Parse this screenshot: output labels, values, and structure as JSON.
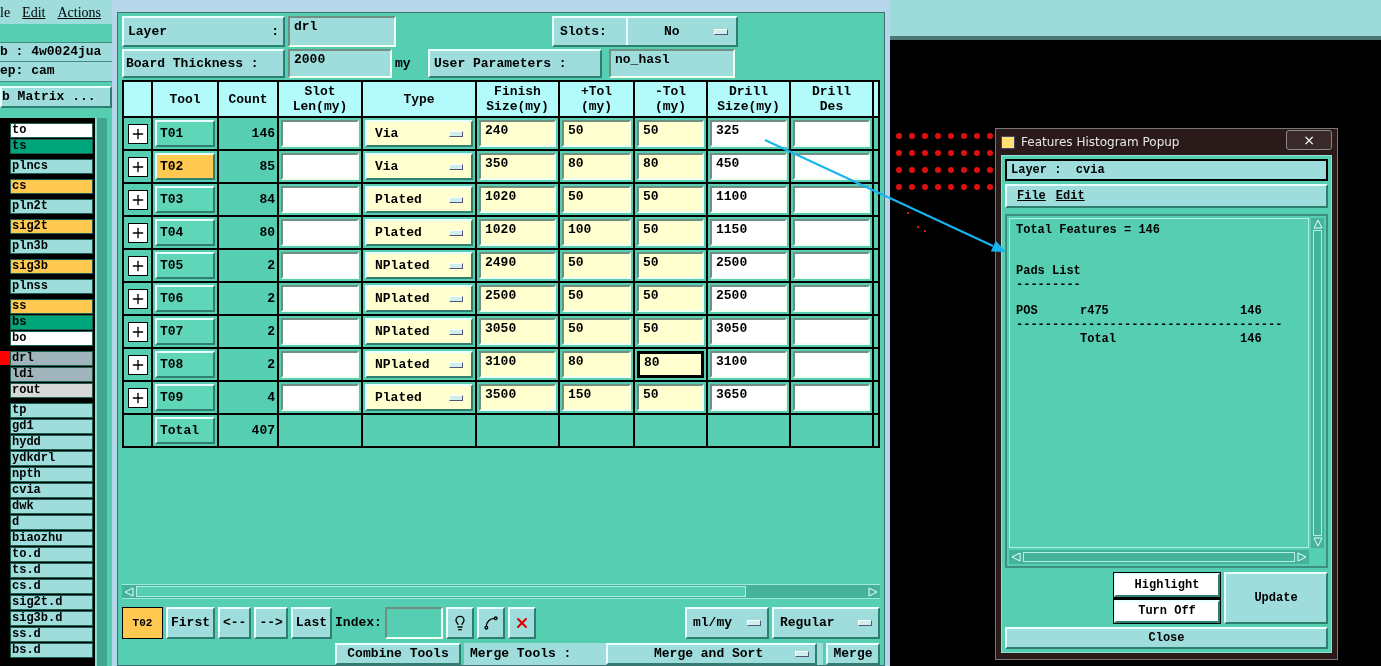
{
  "main_window": {
    "menu": [
      "le",
      "Edit",
      "Actions"
    ],
    "job": "b : 4w0024jua",
    "step": "ep: cam",
    "matrix_button": "b Matrix ...",
    "layer_groups": [
      [
        {
          "name": "to",
          "color": "#ffffff",
          "marked": false
        },
        {
          "name": "ts",
          "color": "#00a57a",
          "marked": false
        }
      ],
      [
        {
          "name": "plncs",
          "color": "#9fdcdc",
          "marked": false
        }
      ],
      [
        {
          "name": "cs",
          "color": "#ffc850",
          "marked": false
        }
      ],
      [
        {
          "name": "pln2t",
          "color": "#9fdcdc",
          "marked": false
        }
      ],
      [
        {
          "name": "sig2t",
          "color": "#ffc850",
          "marked": false
        }
      ],
      [
        {
          "name": "pln3b",
          "color": "#9fdcdc",
          "marked": false
        }
      ],
      [
        {
          "name": "sig3b",
          "color": "#ffc850",
          "marked": false
        }
      ],
      [
        {
          "name": "plnss",
          "color": "#9fdcdc",
          "marked": false
        }
      ],
      [
        {
          "name": "ss",
          "color": "#ffc850",
          "marked": false
        },
        {
          "name": "bs",
          "color": "#00a57a",
          "marked": false
        },
        {
          "name": "bo",
          "color": "#ffffff",
          "marked": false
        }
      ],
      [
        {
          "name": "drl",
          "color": "#9fb4bb",
          "marked": true
        },
        {
          "name": "ldi",
          "color": "#9fb4bb",
          "marked": false
        },
        {
          "name": "rout",
          "color": "#d8d8d8",
          "marked": false
        }
      ],
      [
        {
          "name": "tp",
          "color": "#9fdcdc",
          "marked": false
        },
        {
          "name": "gd1",
          "color": "#9fdcdc",
          "marked": false
        },
        {
          "name": "hydd",
          "color": "#9fdcdc",
          "marked": false
        },
        {
          "name": "ydkdrl",
          "color": "#9fdcdc",
          "marked": false
        },
        {
          "name": "npth",
          "color": "#9fdcdc",
          "marked": false
        },
        {
          "name": "cvia",
          "color": "#9fdcdc",
          "marked": false
        },
        {
          "name": "dwk",
          "color": "#9fdcdc",
          "marked": false
        },
        {
          "name": "d",
          "color": "#9fdcdc",
          "marked": false
        },
        {
          "name": "biaozhu",
          "color": "#9fdcdc",
          "marked": false
        },
        {
          "name": "to.d",
          "color": "#9fdcdc",
          "marked": false
        },
        {
          "name": "ts.d",
          "color": "#9fdcdc",
          "marked": false
        },
        {
          "name": "cs.d",
          "color": "#9fdcdc",
          "marked": false
        },
        {
          "name": "sig2t.d",
          "color": "#9fdcdc",
          "marked": false
        },
        {
          "name": "sig3b.d",
          "color": "#9fdcdc",
          "marked": false
        },
        {
          "name": "ss.d",
          "color": "#9fdcdc",
          "marked": false
        },
        {
          "name": "bs.d",
          "color": "#9fdcdc",
          "marked": false
        }
      ]
    ]
  },
  "drill_manager": {
    "layer_label": "Layer :",
    "layer_value": "drl",
    "slots_label": "Slots:",
    "slots_value": "No",
    "thickness_label": "Board Thickness :",
    "thickness_value": "2000",
    "thickness_unit": "my",
    "user_params_button": "User Parameters :",
    "user_params_value": "no_hasl",
    "columns": [
      "Tool",
      "Count",
      "Slot\nLen(my)",
      "Type",
      "Finish\nSize(my)",
      "+Tol\n(my)",
      "-Tol\n(my)",
      "Drill\nSize(my)",
      "Drill\nDes"
    ],
    "rows": [
      {
        "tool": "T01",
        "selected": false,
        "count": "146",
        "type": "Via",
        "finish": "240",
        "plus_tol": "50",
        "minus_tol": "50",
        "minus_tol_focused": false,
        "drill_size": "325"
      },
      {
        "tool": "T02",
        "selected": true,
        "count": "85",
        "type": "Via",
        "finish": "350",
        "plus_tol": "80",
        "minus_tol": "80",
        "minus_tol_focused": false,
        "drill_size": "450"
      },
      {
        "tool": "T03",
        "selected": false,
        "count": "84",
        "type": "Plated",
        "finish": "1020",
        "plus_tol": "50",
        "minus_tol": "50",
        "minus_tol_focused": false,
        "drill_size": "1100"
      },
      {
        "tool": "T04",
        "selected": false,
        "count": "80",
        "type": "Plated",
        "finish": "1020",
        "plus_tol": "100",
        "minus_tol": "50",
        "minus_tol_focused": false,
        "drill_size": "1150"
      },
      {
        "tool": "T05",
        "selected": false,
        "count": "2",
        "type": "NPlated",
        "finish": "2490",
        "plus_tol": "50",
        "minus_tol": "50",
        "minus_tol_focused": false,
        "drill_size": "2500"
      },
      {
        "tool": "T06",
        "selected": false,
        "count": "2",
        "type": "NPlated",
        "finish": "2500",
        "plus_tol": "50",
        "minus_tol": "50",
        "minus_tol_focused": false,
        "drill_size": "2500"
      },
      {
        "tool": "T07",
        "selected": false,
        "count": "2",
        "type": "NPlated",
        "finish": "3050",
        "plus_tol": "50",
        "minus_tol": "50",
        "minus_tol_focused": false,
        "drill_size": "3050"
      },
      {
        "tool": "T08",
        "selected": false,
        "count": "2",
        "type": "NPlated",
        "finish": "3100",
        "plus_tol": "80",
        "minus_tol": "80",
        "minus_tol_focused": true,
        "drill_size": "3100"
      },
      {
        "tool": "T09",
        "selected": false,
        "count": "4",
        "type": "Plated",
        "finish": "3500",
        "plus_tol": "150",
        "minus_tol": "50",
        "minus_tol_focused": false,
        "drill_size": "3650"
      }
    ],
    "total": {
      "label": "Total",
      "count": "407"
    },
    "current_tool": "T02",
    "nav_buttons": [
      "First",
      "<--",
      "-->",
      "Last"
    ],
    "index_label": "Index:",
    "units": "ml/my",
    "mode": "Regular",
    "combine_button": "Combine Tools",
    "merge_label": "Merge Tools :",
    "merge_mode": "Merge and Sort",
    "merge_button": "Merge"
  },
  "popup": {
    "title": "Features Histogram Popup",
    "close": "×",
    "layer": "Layer :  cvia",
    "menu": [
      "File",
      "Edit"
    ],
    "report": [
      {
        "kind": "text",
        "text": "Total Features = 146"
      },
      {
        "kind": "heading",
        "text": "Pads List"
      },
      {
        "kind": "underline",
        "text": "---------"
      },
      {
        "kind": "row",
        "cells": [
          "POS",
          "r475",
          "146"
        ]
      },
      {
        "kind": "rule",
        "text": "-------------------------------------"
      },
      {
        "kind": "total",
        "label": "Total",
        "value": "146"
      }
    ],
    "highlight_button": "Highlight",
    "turn_off_button": "Turn Off",
    "update_button": "Update",
    "close_button": "Close"
  }
}
